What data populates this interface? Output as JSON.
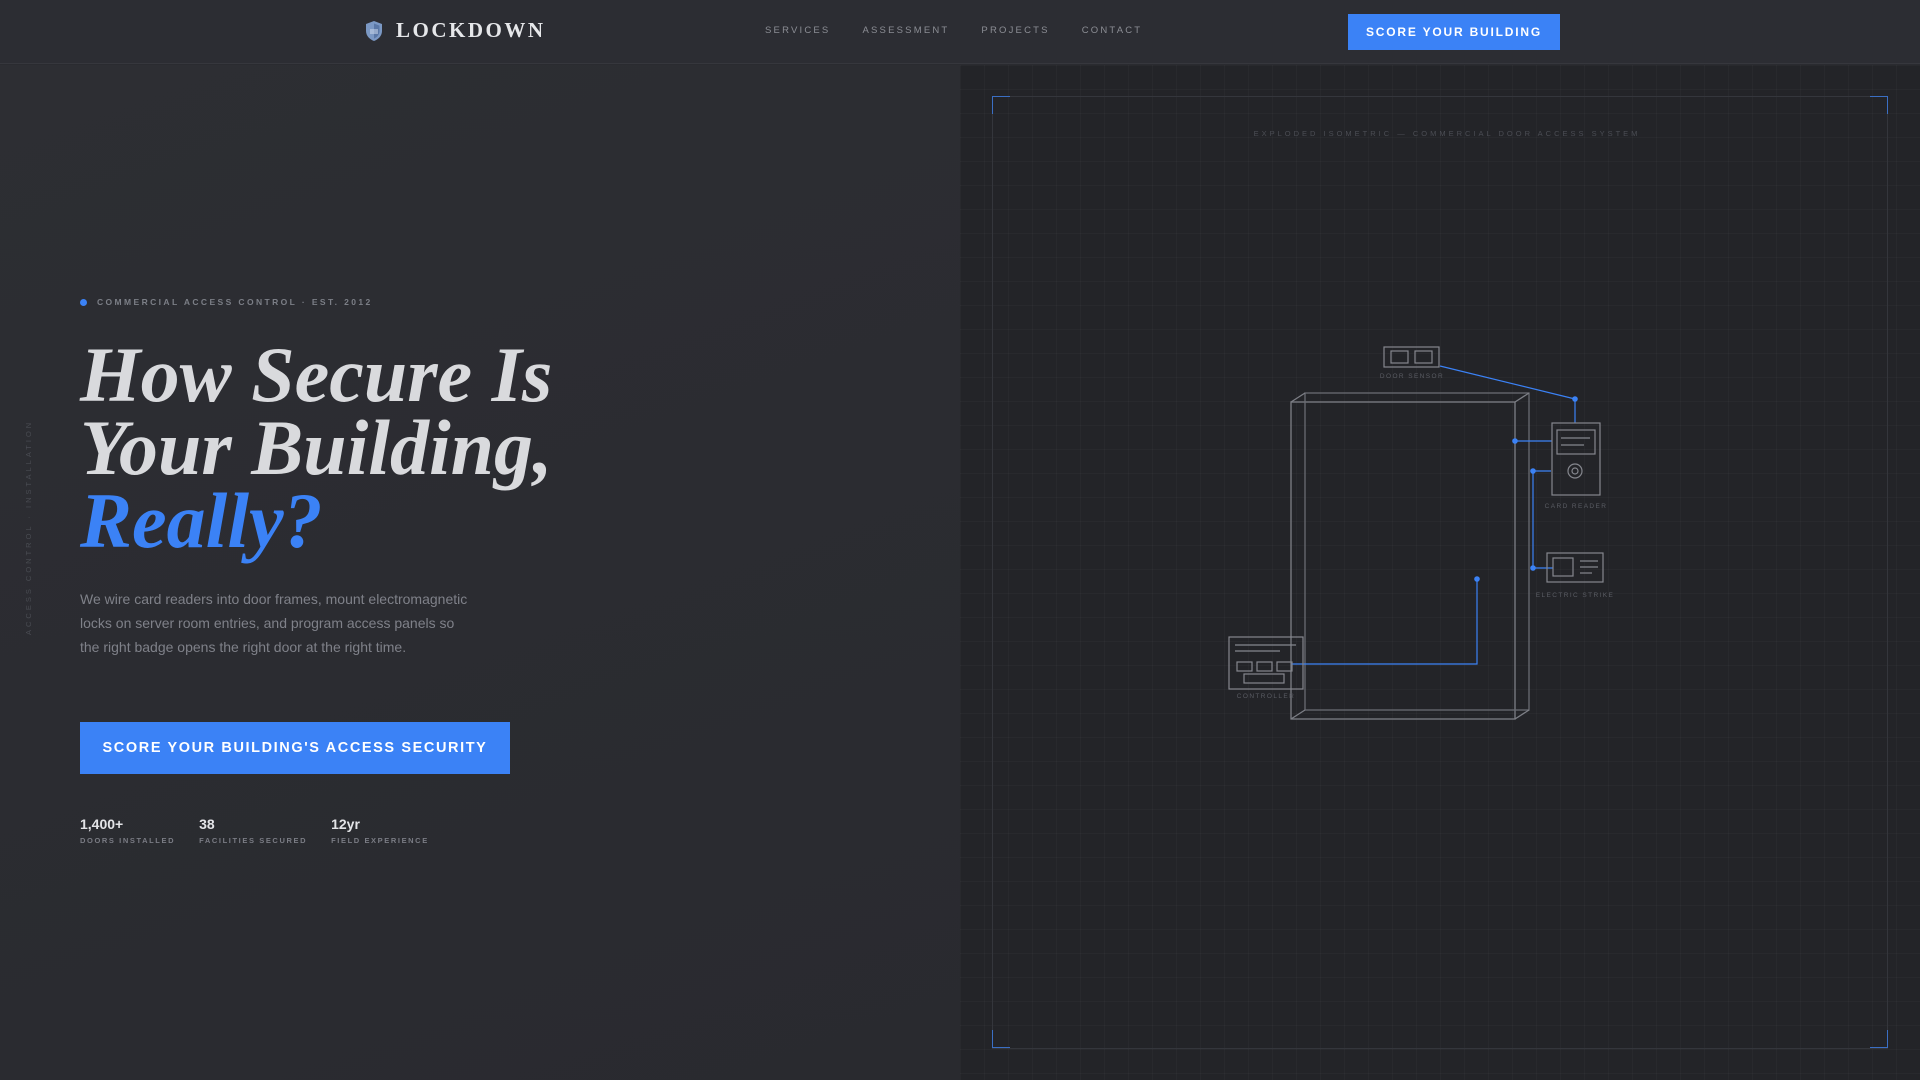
{
  "brand": {
    "name": "LOCKDOWN",
    "icon": "shield-icon",
    "accent_color": "#3b82f6"
  },
  "nav": {
    "links": [
      "SERVICES",
      "ASSESSMENT",
      "PROJECTS",
      "CONTACT"
    ],
    "cta_label": "SCORE YOUR BUILDING"
  },
  "hero": {
    "eyebrow": "COMMERCIAL ACCESS CONTROL · EST. 2012",
    "headline_line1": "How Secure Is",
    "headline_line2": "Your Building,",
    "headline_accent": "Really?",
    "description": "We wire card readers into door frames, mount electromagnetic locks on server room entries, and program access panels so the right badge opens the right door at the right time.",
    "cta_label": "SCORE YOUR BUILDING'S ACCESS SECURITY",
    "vertical_tag": "ACCESS CONTROL · INSTALLATION",
    "stats": [
      {
        "value": "1,400+",
        "label": "DOORS INSTALLED"
      },
      {
        "value": "38",
        "label": "FACILITIES SECURED"
      },
      {
        "value": "12yr",
        "label": "FIELD EXPERIENCE"
      }
    ]
  },
  "diagram": {
    "caption": "EXPLODED ISOMETRIC — COMMERCIAL DOOR ACCESS SYSTEM",
    "labels": {
      "door_sensor": "DOOR SENSOR",
      "card_reader": "CARD READER",
      "electric_strike": "ELECTRIC STRIKE",
      "controller": "CONTROLLER"
    }
  }
}
